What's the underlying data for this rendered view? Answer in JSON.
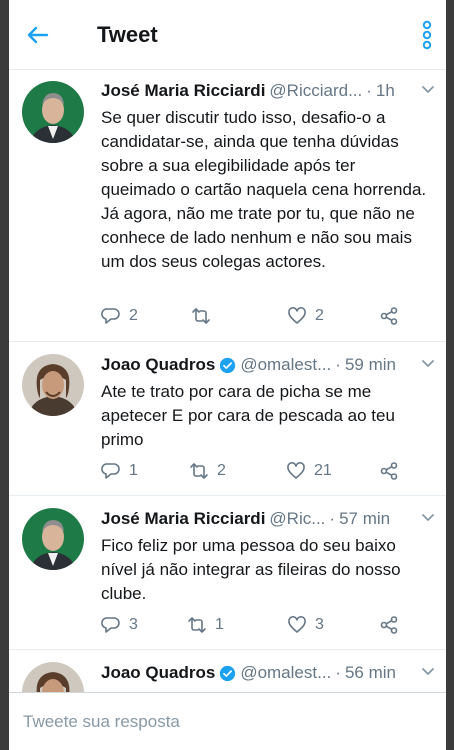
{
  "header": {
    "title": "Tweet"
  },
  "tweets": [
    {
      "name": "José Maria Ricciardi",
      "handle": "@Ricciard...",
      "time": "1h",
      "text": "Se quer discutir tudo isso, desafio-o a candidatar-se, ainda que tenha dúvidas sobre a sua elegibilidade após ter queimado o cartão naquela cena horrenda. Já agora, não me trate por tu, que não ne conhece de lado nenhum e não sou mais um dos seus colegas actores.",
      "replies": "2",
      "retweets": "",
      "likes": "2",
      "verified": false
    },
    {
      "name": "Joao Quadros",
      "handle": "@omalest...",
      "time": "59 min",
      "text": "Ate te trato por cara de picha se me apetecer E por cara de pescada ao teu primo",
      "replies": "1",
      "retweets": "2",
      "likes": "21",
      "verified": true
    },
    {
      "name": "José Maria Ricciardi",
      "handle": "@Ric...",
      "time": "57 min",
      "text": "Fico feliz por uma pessoa do seu baixo nível já não integrar as fileiras do nosso clube.",
      "replies": "3",
      "retweets": "1",
      "likes": "3",
      "verified": false
    },
    {
      "name": "Joao Quadros",
      "handle": "@omalest...",
      "time": "56 min",
      "verified": true
    }
  ],
  "reply_bar": {
    "placeholder": "Tweete sua resposta"
  },
  "colors": {
    "accent": "#1da1f2",
    "secondary_text": "#657786",
    "avatar_green": "#1e7a46"
  },
  "icons": [
    "back-arrow-icon",
    "more-vertical-icon",
    "chevron-down-icon",
    "reply-icon",
    "retweet-icon",
    "like-icon",
    "share-icon",
    "verified-icon"
  ]
}
